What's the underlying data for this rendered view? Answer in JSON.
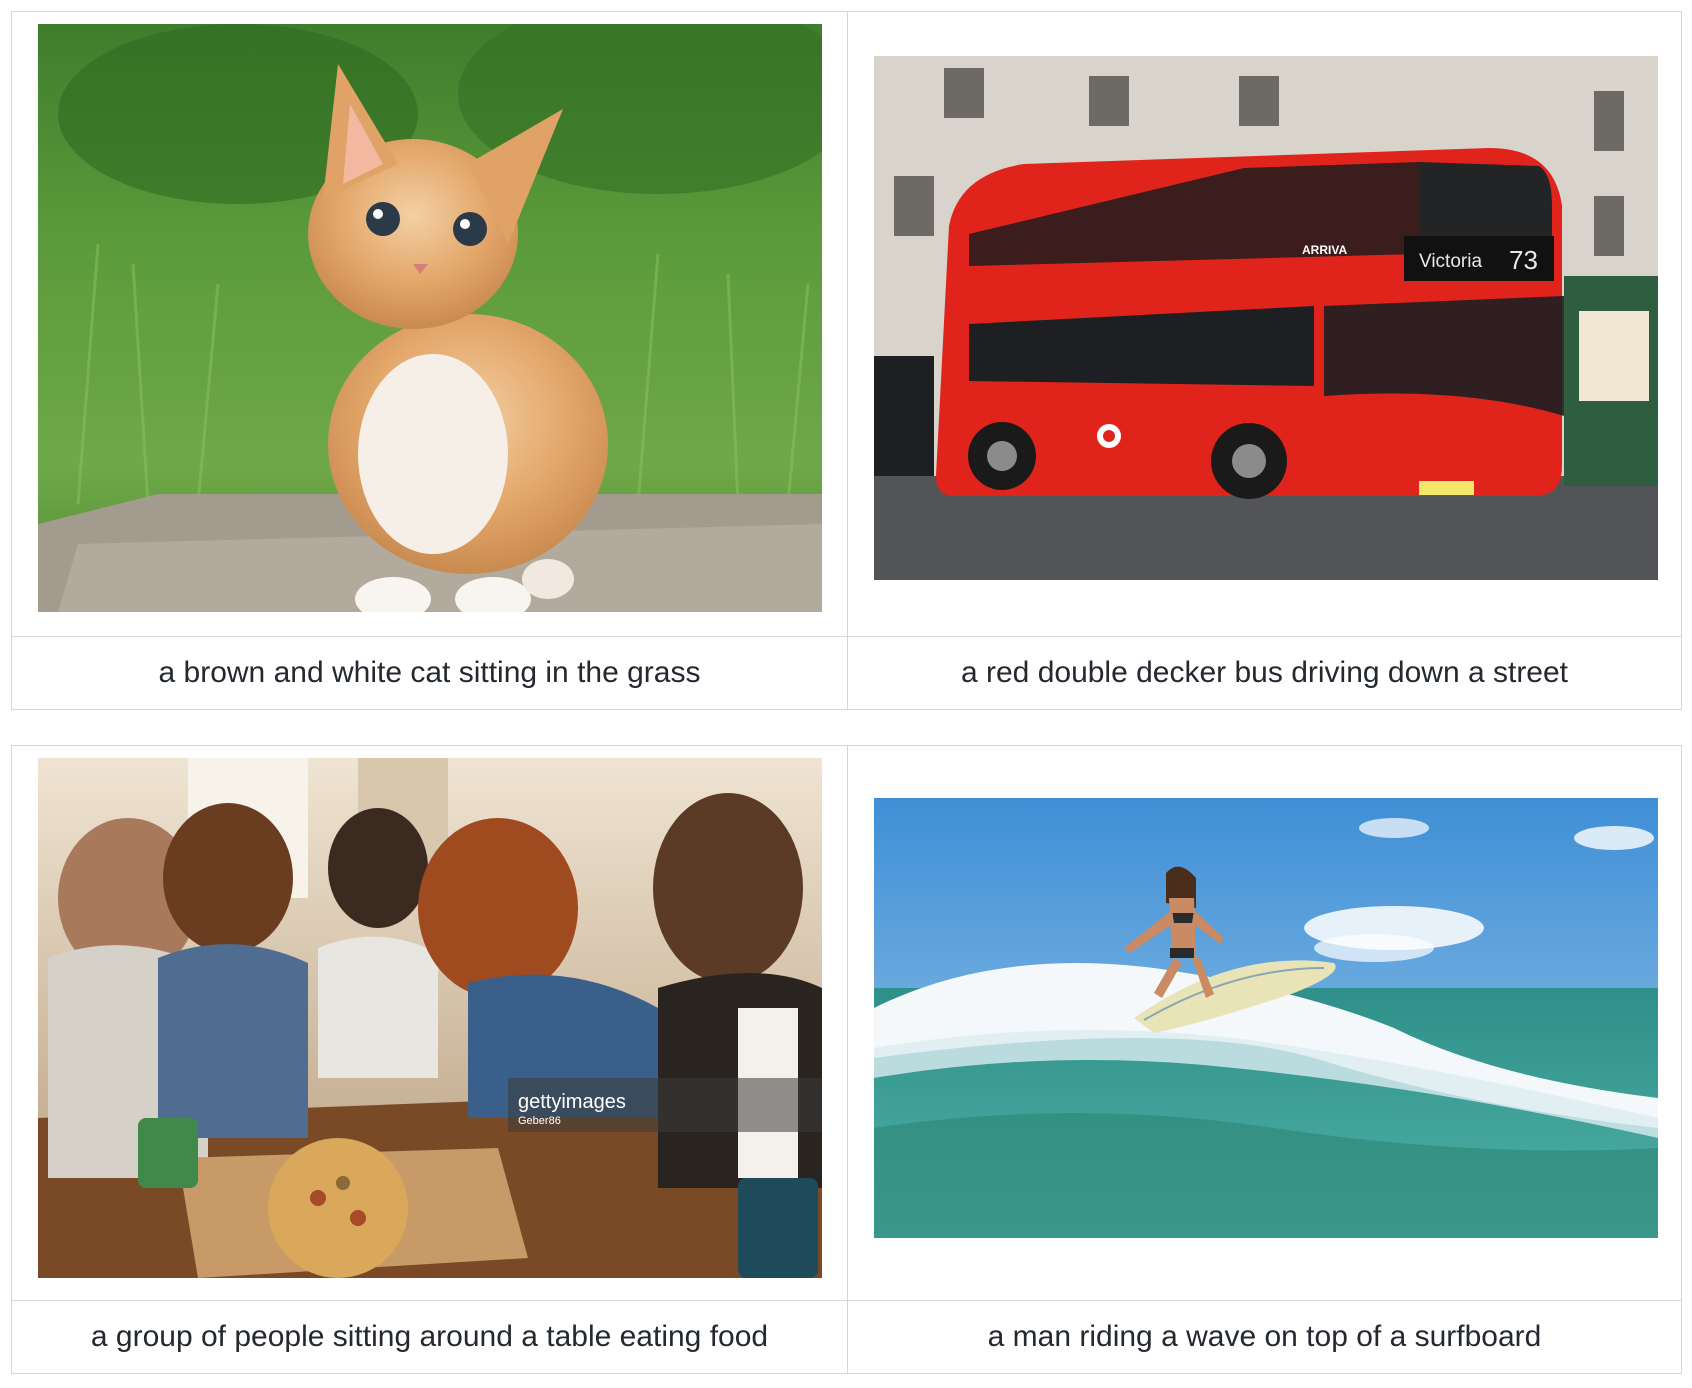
{
  "rows": [
    [
      {
        "image_subject": "kitten-photo",
        "caption": "a brown and white cat sitting in the grass"
      },
      {
        "image_subject": "bus-photo",
        "caption": "a red double decker bus driving down a street",
        "signage": {
          "operator": "ARRIVA",
          "destination": "Victoria",
          "route": "73"
        }
      }
    ],
    [
      {
        "image_subject": "people-eating-photo",
        "caption": "a group of people sitting around a table eating food",
        "watermark": {
          "brand": "gettyimages",
          "credit": "Geber86"
        }
      },
      {
        "image_subject": "surfer-photo",
        "caption": "a man riding a wave on top of a surfboard"
      }
    ]
  ],
  "colors": {
    "border": "#d0d7de",
    "caption_text": "#24292f",
    "bus_red": "#e0241b"
  }
}
